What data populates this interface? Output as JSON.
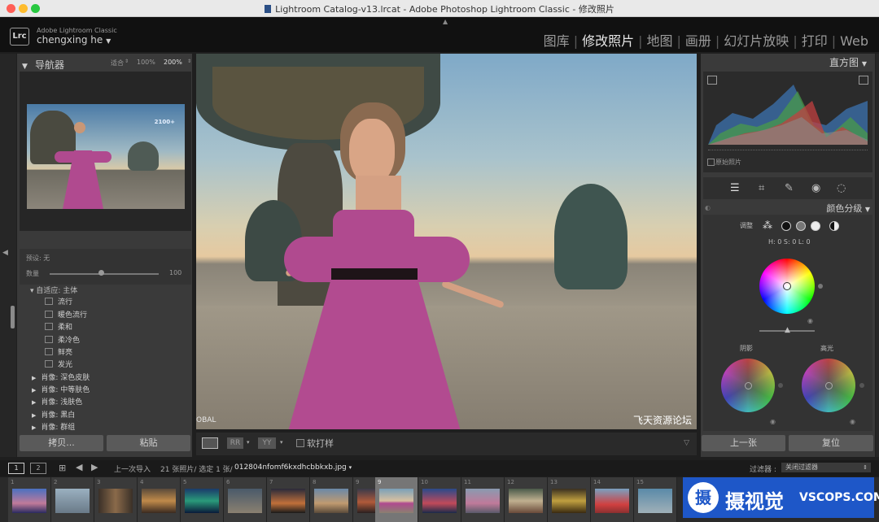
{
  "window": {
    "title": "Lightroom Catalog-v13.lrcat - Adobe Photoshop Lightroom Classic - 修改照片"
  },
  "identity": {
    "logo": "Lrc",
    "app_name": "Adobe Lightroom Classic",
    "user": "chengxing he"
  },
  "modules": [
    {
      "label": "图库",
      "active": false
    },
    {
      "label": "修改照片",
      "active": true
    },
    {
      "label": "地图",
      "active": false
    },
    {
      "label": "画册",
      "active": false
    },
    {
      "label": "幻灯片放映",
      "active": false
    },
    {
      "label": "打印",
      "active": false
    },
    {
      "label": "Web",
      "active": false
    }
  ],
  "navigator": {
    "title": "导航器",
    "fit": "适合",
    "zoom1": "100%",
    "zoom2": "200%",
    "preview_badge": "2100+"
  },
  "preset_strip": {
    "label": "预设: 无",
    "amount_label": "数量",
    "amount_value": "100"
  },
  "presets": {
    "group_header": "自适应: 主体",
    "items": [
      "流行",
      "暖色流行",
      "柔和",
      "柔冷色",
      "鲜亮",
      "发光"
    ],
    "groups": [
      "肖像: 深色皮肤",
      "肖像: 中等肤色",
      "肖像: 浅肤色",
      "肖像: 黑白",
      "肖像: 群组"
    ]
  },
  "left_buttons": {
    "copy": "拷贝...",
    "paste": "粘贴"
  },
  "histogram": {
    "title": "直方图",
    "original_label": "原始照片"
  },
  "color_grading": {
    "title": "颜色分级",
    "adjust_label": "调整",
    "readout": "H: 0 S: 0 L: 0",
    "shadows": "阴影",
    "highlights": "高光"
  },
  "right_buttons": {
    "previous": "上一张",
    "reset": "复位"
  },
  "toolbar": {
    "softproof": "软打样"
  },
  "photo": {
    "watermark": "飞天资源论坛",
    "left_mark": "OBAL"
  },
  "filmstrip_header": {
    "page1": "1",
    "page2": "2",
    "source": "上一次导入",
    "count": "21 张照片/ 选定 1 张/",
    "filename": "012804nfomf6kxdhcbbkxb.jpg",
    "filter_label": "过滤器 :",
    "filter_value": "关闭过滤器"
  },
  "filmstrip": {
    "numbers": [
      "1",
      "2",
      "3",
      "4",
      "5",
      "6",
      "7",
      "8",
      "9",
      "10",
      "11",
      "12",
      "13",
      "14",
      "15"
    ],
    "selected": "9"
  },
  "badge": {
    "name": "摄视觉",
    "domain": "VSCOPS.COM"
  },
  "colors": {
    "badge_blue": "#1e57c8",
    "accent_pink": "#b04a8f"
  }
}
